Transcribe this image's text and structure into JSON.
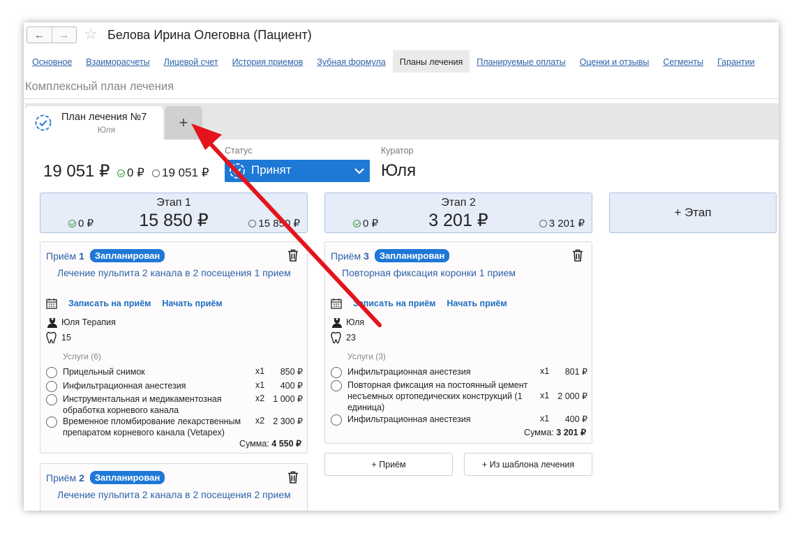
{
  "window": {
    "title": "Белова Ирина Олеговна (Пациент)",
    "back_icon": "←",
    "forward_icon": "→"
  },
  "tabs": [
    {
      "label": "Основное",
      "active": false
    },
    {
      "label": "Взаиморасчеты",
      "active": false
    },
    {
      "label": "Лицевой счет",
      "active": false
    },
    {
      "label": "История приемов",
      "active": false
    },
    {
      "label": "Зубная формула",
      "active": false
    },
    {
      "label": "Планы лечения",
      "active": true
    },
    {
      "label": "Планируемые оплаты",
      "active": false
    },
    {
      "label": "Оценки и отзывы",
      "active": false
    },
    {
      "label": "Сегменты",
      "active": false
    },
    {
      "label": "Гарантии",
      "active": false
    }
  ],
  "section_title": "Комплексный план лечения",
  "plan_tab": {
    "title": "План лечения №7",
    "subtitle": "Юля",
    "add_label": "+"
  },
  "summary": {
    "total": "19 051 ₽",
    "paid": "0 ₽",
    "remaining": "19 051 ₽"
  },
  "status": {
    "label": "Статус",
    "value": "Принят"
  },
  "curator": {
    "label": "Куратор",
    "value": "Юля"
  },
  "stages": [
    {
      "name": "Этап 1",
      "amount": "15 850 ₽",
      "paid": "0 ₽",
      "remaining": "15 850 ₽"
    },
    {
      "name": "Этап 2",
      "amount": "3 201 ₽",
      "paid": "0 ₽",
      "remaining": "3 201 ₽"
    }
  ],
  "add_stage_label": "+ Этап",
  "actions": {
    "book": "Записать на приём",
    "start": "Начать приём"
  },
  "appointments": [
    {
      "prefix": "Приём",
      "num": "1",
      "badge": "Запланирован",
      "title": "Лечение пульпита 2 канала в 2 посещения 1 прием",
      "doctor": "Юля Терапия",
      "tooth": "15",
      "services_label": "Услуги (6)",
      "services": [
        {
          "name": "Прицельный снимок",
          "qty": "x1",
          "price": "850 ₽"
        },
        {
          "name": "Инфильтрационная анестезия",
          "qty": "x1",
          "price": "400 ₽"
        },
        {
          "name": "Инструментальная и медикаментозная обработка корневого канала",
          "qty": "x2",
          "price": "1 000 ₽"
        },
        {
          "name": "Временное пломбирование лекарственным препаратом корневого канала (Vetapex)",
          "qty": "x2",
          "price": "2 300 ₽"
        }
      ],
      "sum_label": "Сумма:",
      "sum": "4 550 ₽"
    },
    {
      "prefix": "Приём",
      "num": "3",
      "badge": "Запланирован",
      "title": "Повторная фиксация коронки 1 прием",
      "doctor": "Юля",
      "tooth": "23",
      "services_label": "Услуги (3)",
      "services": [
        {
          "name": "Инфильтрационная анестезия",
          "qty": "x1",
          "price": "801 ₽"
        },
        {
          "name": "Повторная фиксация на постоянный цемент несъемных ортопедических конструкций (1 единица)",
          "qty": "x1",
          "price": "2 000 ₽"
        },
        {
          "name": "Инфильтрационная анестезия",
          "qty": "x1",
          "price": "400 ₽"
        }
      ],
      "sum_label": "Сумма:",
      "sum": "3 201 ₽"
    },
    {
      "prefix": "Приём",
      "num": "2",
      "badge": "Запланирован",
      "title": "Лечение пульпита 2 канала в 2 посещения 2 прием"
    }
  ],
  "buttons": {
    "add_visit": "+ Приём",
    "from_template": "+ Из шаблона лечения"
  },
  "colors": {
    "accent": "#1e78d6",
    "link": "#2d63a8",
    "stage_bg": "#e6ecf8",
    "annotation_arrow": "#e3141c"
  }
}
